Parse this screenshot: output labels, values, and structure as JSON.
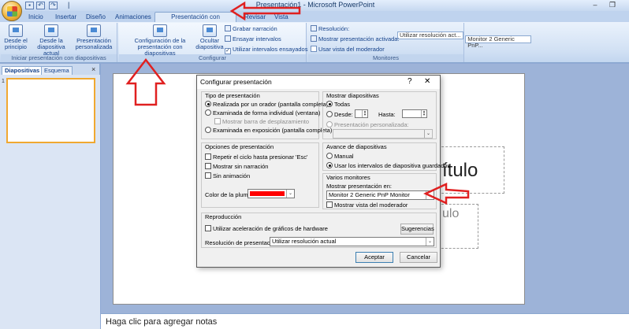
{
  "window": {
    "title": "Presentación1 - Microsoft PowerPoint",
    "qat_icons": [
      "save-icon",
      "undo-icon",
      "redo-icon"
    ],
    "controls": [
      "minimize-icon",
      "maximize-icon"
    ]
  },
  "tabs": [
    {
      "label": "Inicio"
    },
    {
      "label": "Insertar"
    },
    {
      "label": "Diseño"
    },
    {
      "label": "Animaciones"
    },
    {
      "label": "Presentación con diapositivas",
      "active": true
    },
    {
      "label": "Revisar"
    },
    {
      "label": "Vista"
    }
  ],
  "ribbon": {
    "group1": {
      "label": "Iniciar presentación con diapositivas",
      "btn1": "Desde el principio",
      "btn2": "Desde la diapositiva actual",
      "btn3": "Presentación personalizada"
    },
    "group2": {
      "label": "Configurar",
      "btn1": "Configuración de la presentación con diapositivas",
      "btn2": "Ocultar diapositiva",
      "item1": "Grabar narración",
      "item2": "Ensayar intervalos",
      "item3": "Utilizar intervalos ensayados"
    },
    "group3": {
      "label": "Monitores",
      "resolution_label": "Resolución:",
      "resolution_value": "Utilizar resolución act...",
      "show_on_label": "Mostrar presentación activada:",
      "show_on_value": "Monitor 2 Generic PnP...",
      "presenter_view": "Usar vista del moderador"
    }
  },
  "left_pane": {
    "tab1": "Diapositivas",
    "tab2": "Esquema",
    "close": "×",
    "slide_number": "1"
  },
  "slide": {
    "title_partial": "ítulo",
    "subtitle_partial": "ulo"
  },
  "notes": "Haga clic para agregar notas",
  "dialog": {
    "title": "Configurar presentación",
    "help": "?",
    "close": "✕",
    "tipo": {
      "label": "Tipo de presentación",
      "opt1": "Realizada por un orador (pantalla completa)",
      "opt2": "Examinada de forma individual (ventana)",
      "opt2_sub": "Mostrar barra de desplazamiento",
      "opt3": "Examinada en exposición (pantalla completa)"
    },
    "opciones": {
      "label": "Opciones de presentación",
      "chk1": "Repetir el ciclo hasta presionar 'Esc'",
      "chk2": "Mostrar sin narración",
      "chk3": "Sin animación",
      "pen_color_label": "Color de la pluma:",
      "pen_color": "#ff0000"
    },
    "mostrar": {
      "label": "Mostrar diapositivas",
      "opt1": "Todas",
      "desde": "Desde:",
      "hasta": "Hasta:",
      "custom": "Presentación personalizada:"
    },
    "avance": {
      "label": "Avance de diapositivas",
      "opt1": "Manual",
      "opt2": "Usar los intervalos de diapositiva guardados"
    },
    "monitores": {
      "label": "Varios monitores",
      "show_on_label": "Mostrar presentación en:",
      "show_on_value": "Monitor 2 Generic PnP Monitor",
      "presenter_view": "Mostrar vista del moderador"
    },
    "reproduccion": {
      "label": "Reproducción",
      "chk1": "Utilizar aceleración de gráficos de hardware",
      "tips_button": "Sugerencias",
      "resolution_label": "Resolución de presentación:",
      "resolution_value": "Utilizar resolución actual"
    },
    "accept": "Aceptar",
    "cancel": "Cancelar"
  }
}
